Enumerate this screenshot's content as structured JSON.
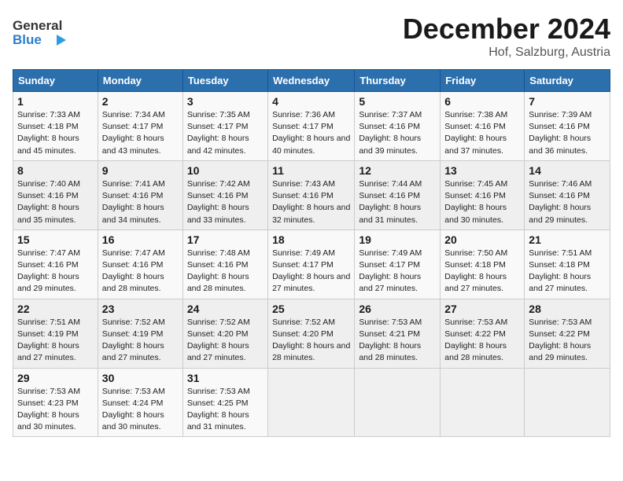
{
  "header": {
    "logo_line1": "General",
    "logo_line2": "Blue",
    "month": "December 2024",
    "location": "Hof, Salzburg, Austria"
  },
  "weekdays": [
    "Sunday",
    "Monday",
    "Tuesday",
    "Wednesday",
    "Thursday",
    "Friday",
    "Saturday"
  ],
  "weeks": [
    [
      {
        "day": "1",
        "sunrise": "Sunrise: 7:33 AM",
        "sunset": "Sunset: 4:18 PM",
        "daylight": "Daylight: 8 hours and 45 minutes."
      },
      {
        "day": "2",
        "sunrise": "Sunrise: 7:34 AM",
        "sunset": "Sunset: 4:17 PM",
        "daylight": "Daylight: 8 hours and 43 minutes."
      },
      {
        "day": "3",
        "sunrise": "Sunrise: 7:35 AM",
        "sunset": "Sunset: 4:17 PM",
        "daylight": "Daylight: 8 hours and 42 minutes."
      },
      {
        "day": "4",
        "sunrise": "Sunrise: 7:36 AM",
        "sunset": "Sunset: 4:17 PM",
        "daylight": "Daylight: 8 hours and 40 minutes."
      },
      {
        "day": "5",
        "sunrise": "Sunrise: 7:37 AM",
        "sunset": "Sunset: 4:16 PM",
        "daylight": "Daylight: 8 hours and 39 minutes."
      },
      {
        "day": "6",
        "sunrise": "Sunrise: 7:38 AM",
        "sunset": "Sunset: 4:16 PM",
        "daylight": "Daylight: 8 hours and 37 minutes."
      },
      {
        "day": "7",
        "sunrise": "Sunrise: 7:39 AM",
        "sunset": "Sunset: 4:16 PM",
        "daylight": "Daylight: 8 hours and 36 minutes."
      }
    ],
    [
      {
        "day": "8",
        "sunrise": "Sunrise: 7:40 AM",
        "sunset": "Sunset: 4:16 PM",
        "daylight": "Daylight: 8 hours and 35 minutes."
      },
      {
        "day": "9",
        "sunrise": "Sunrise: 7:41 AM",
        "sunset": "Sunset: 4:16 PM",
        "daylight": "Daylight: 8 hours and 34 minutes."
      },
      {
        "day": "10",
        "sunrise": "Sunrise: 7:42 AM",
        "sunset": "Sunset: 4:16 PM",
        "daylight": "Daylight: 8 hours and 33 minutes."
      },
      {
        "day": "11",
        "sunrise": "Sunrise: 7:43 AM",
        "sunset": "Sunset: 4:16 PM",
        "daylight": "Daylight: 8 hours and 32 minutes."
      },
      {
        "day": "12",
        "sunrise": "Sunrise: 7:44 AM",
        "sunset": "Sunset: 4:16 PM",
        "daylight": "Daylight: 8 hours and 31 minutes."
      },
      {
        "day": "13",
        "sunrise": "Sunrise: 7:45 AM",
        "sunset": "Sunset: 4:16 PM",
        "daylight": "Daylight: 8 hours and 30 minutes."
      },
      {
        "day": "14",
        "sunrise": "Sunrise: 7:46 AM",
        "sunset": "Sunset: 4:16 PM",
        "daylight": "Daylight: 8 hours and 29 minutes."
      }
    ],
    [
      {
        "day": "15",
        "sunrise": "Sunrise: 7:47 AM",
        "sunset": "Sunset: 4:16 PM",
        "daylight": "Daylight: 8 hours and 29 minutes."
      },
      {
        "day": "16",
        "sunrise": "Sunrise: 7:47 AM",
        "sunset": "Sunset: 4:16 PM",
        "daylight": "Daylight: 8 hours and 28 minutes."
      },
      {
        "day": "17",
        "sunrise": "Sunrise: 7:48 AM",
        "sunset": "Sunset: 4:16 PM",
        "daylight": "Daylight: 8 hours and 28 minutes."
      },
      {
        "day": "18",
        "sunrise": "Sunrise: 7:49 AM",
        "sunset": "Sunset: 4:17 PM",
        "daylight": "Daylight: 8 hours and 27 minutes."
      },
      {
        "day": "19",
        "sunrise": "Sunrise: 7:49 AM",
        "sunset": "Sunset: 4:17 PM",
        "daylight": "Daylight: 8 hours and 27 minutes."
      },
      {
        "day": "20",
        "sunrise": "Sunrise: 7:50 AM",
        "sunset": "Sunset: 4:18 PM",
        "daylight": "Daylight: 8 hours and 27 minutes."
      },
      {
        "day": "21",
        "sunrise": "Sunrise: 7:51 AM",
        "sunset": "Sunset: 4:18 PM",
        "daylight": "Daylight: 8 hours and 27 minutes."
      }
    ],
    [
      {
        "day": "22",
        "sunrise": "Sunrise: 7:51 AM",
        "sunset": "Sunset: 4:19 PM",
        "daylight": "Daylight: 8 hours and 27 minutes."
      },
      {
        "day": "23",
        "sunrise": "Sunrise: 7:52 AM",
        "sunset": "Sunset: 4:19 PM",
        "daylight": "Daylight: 8 hours and 27 minutes."
      },
      {
        "day": "24",
        "sunrise": "Sunrise: 7:52 AM",
        "sunset": "Sunset: 4:20 PM",
        "daylight": "Daylight: 8 hours and 27 minutes."
      },
      {
        "day": "25",
        "sunrise": "Sunrise: 7:52 AM",
        "sunset": "Sunset: 4:20 PM",
        "daylight": "Daylight: 8 hours and 28 minutes."
      },
      {
        "day": "26",
        "sunrise": "Sunrise: 7:53 AM",
        "sunset": "Sunset: 4:21 PM",
        "daylight": "Daylight: 8 hours and 28 minutes."
      },
      {
        "day": "27",
        "sunrise": "Sunrise: 7:53 AM",
        "sunset": "Sunset: 4:22 PM",
        "daylight": "Daylight: 8 hours and 28 minutes."
      },
      {
        "day": "28",
        "sunrise": "Sunrise: 7:53 AM",
        "sunset": "Sunset: 4:22 PM",
        "daylight": "Daylight: 8 hours and 29 minutes."
      }
    ],
    [
      {
        "day": "29",
        "sunrise": "Sunrise: 7:53 AM",
        "sunset": "Sunset: 4:23 PM",
        "daylight": "Daylight: 8 hours and 30 minutes."
      },
      {
        "day": "30",
        "sunrise": "Sunrise: 7:53 AM",
        "sunset": "Sunset: 4:24 PM",
        "daylight": "Daylight: 8 hours and 30 minutes."
      },
      {
        "day": "31",
        "sunrise": "Sunrise: 7:53 AM",
        "sunset": "Sunset: 4:25 PM",
        "daylight": "Daylight: 8 hours and 31 minutes."
      },
      null,
      null,
      null,
      null
    ]
  ]
}
